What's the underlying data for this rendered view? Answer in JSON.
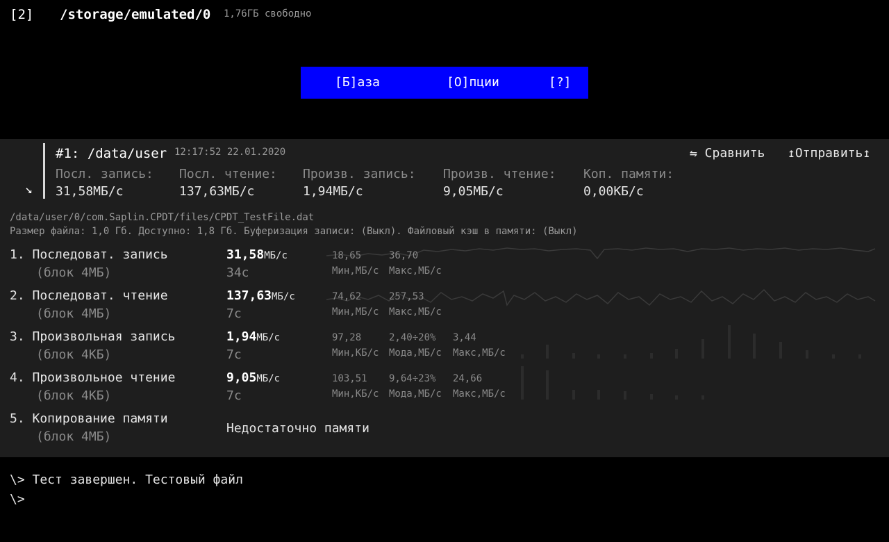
{
  "top": {
    "drive_num": "[2]",
    "drive_path": "/storage/emulated/0",
    "free_space": "1,76ГБ свободно"
  },
  "menu": {
    "items": [
      {
        "label": "[Б]аза"
      },
      {
        "label": "[О]пции"
      },
      {
        "label": "[?]"
      }
    ],
    "bg_color": "#0000ff"
  },
  "run": {
    "title": "#1: /data/user",
    "time": "12:17:52 22.01.2020",
    "compare": "⇋ Сравнить",
    "send": "↥Отправить↥",
    "expand_icon": "↘",
    "stats": [
      {
        "label": "Посл. запись:",
        "value": "31,58МБ/с"
      },
      {
        "label": "Посл. чтение:",
        "value": "137,63МБ/с"
      },
      {
        "label": "Произв. запись:",
        "value": "1,94МБ/с"
      },
      {
        "label": "Произв. чтение:",
        "value": "9,05МБ/с"
      },
      {
        "label": "Коп. памяти:",
        "value": "0,00КБ/с"
      }
    ]
  },
  "file": {
    "path": "/data/user/0/com.Saplin.CPDT/files/CPDT_TestFile.dat",
    "info": "Размер файла: 1,0 Гб. Доступно: 1,8 Гб. Буферизация записи: (Выкл). Файловый кэш в памяти: (Выкл)"
  },
  "tests": [
    {
      "title": "1. Последоват. запись",
      "sub": "(блок 4МБ)",
      "value": "31,58",
      "unit": "МБ/с",
      "time": "34с",
      "metrics": [
        {
          "num": "18,65",
          "label": "Мин,МБ/с"
        },
        {
          "num": "36,70",
          "label": "Макс,МБ/с"
        }
      ]
    },
    {
      "title": "2. Последоват. чтение",
      "sub": "(блок 4МБ)",
      "value": "137,63",
      "unit": "МБ/с",
      "time": "7с",
      "metrics": [
        {
          "num": "74,62",
          "label": "Мин,МБ/с"
        },
        {
          "num": "257,53",
          "label": "Макс,МБ/с"
        }
      ]
    },
    {
      "title": "3. Произвольная запись",
      "sub": "(блок 4КБ)",
      "value": "1,94",
      "unit": "МБ/с",
      "time": "7с",
      "metrics": [
        {
          "num": "97,28",
          "label": "Мин,КБ/с"
        },
        {
          "num": "2,40÷20%",
          "label": "Мода,МБ/с"
        },
        {
          "num": "3,44",
          "label": "Макс,МБ/с"
        }
      ]
    },
    {
      "title": "4. Произвольное чтение",
      "sub": "(блок 4КБ)",
      "value": "9,05",
      "unit": "МБ/с",
      "time": "7с",
      "metrics": [
        {
          "num": "103,51",
          "label": "Мин,КБ/с"
        },
        {
          "num": "9,64÷23%",
          "label": "Мода,МБ/с"
        },
        {
          "num": "24,66",
          "label": "Макс,МБ/с"
        }
      ]
    },
    {
      "title": "5. Копирование памяти",
      "sub": "(блок 4МБ)",
      "message": "Недостаточно памяти"
    }
  ],
  "console": {
    "status": "\\> Тест завершен. Тестовый файл",
    "cursor": "\\>"
  }
}
